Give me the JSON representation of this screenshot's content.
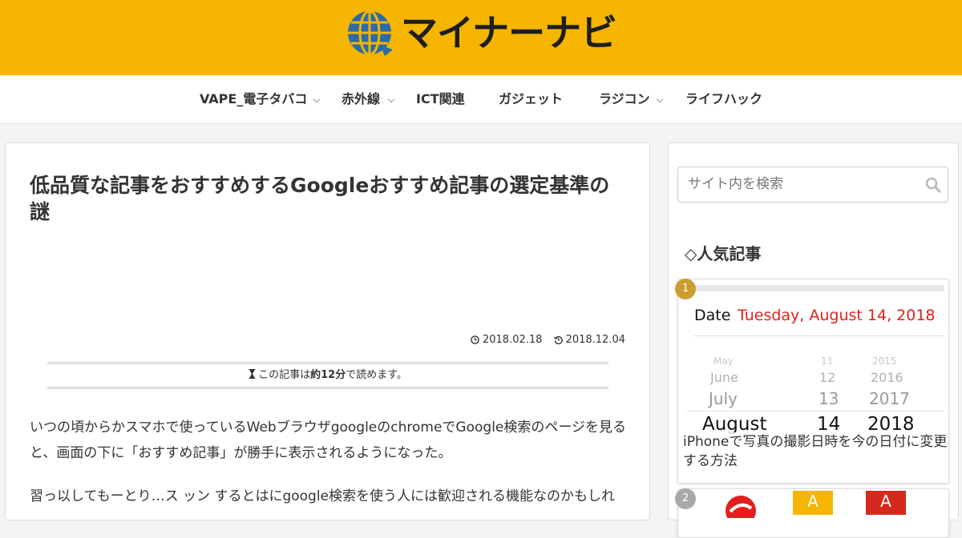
{
  "site": {
    "name": "マイナーナビ"
  },
  "nav": {
    "items": [
      {
        "label": "VAPE_電子タバコ",
        "has_submenu": true
      },
      {
        "label": "赤外線",
        "has_submenu": true
      },
      {
        "label": "ICT関連",
        "has_submenu": false
      },
      {
        "label": "ガジェット",
        "has_submenu": false
      },
      {
        "label": "ラジコン",
        "has_submenu": true
      },
      {
        "label": "ライフハック",
        "has_submenu": false
      }
    ]
  },
  "article": {
    "title": "低品質な記事をおすすめするGoogleおすすめ記事の選定基準の謎",
    "posted": "2018.02.18",
    "updated": "2018.12.04",
    "readtime": {
      "prefix": "この記事は",
      "value": "約12分",
      "suffix": "で読めます。"
    },
    "paragraphs": [
      "いつの頃からかスマホで使っているWebブラウザgoogleのchromeでGoogle検索のページを見ると、画面の下に「おすすめ記事」が勝手に表示されるようになった。",
      "習っ以してもーとり…ス ッン するとはにgoogle検索を使う人には歓迎される機能なのかもしれ"
    ]
  },
  "sidebar": {
    "search": {
      "placeholder": "サイト内を検索"
    },
    "popular": {
      "heading": "◇人気記事",
      "items": [
        {
          "rank": "1",
          "title": "iPhoneで写真の撮影日時を今の日付に変更する方法",
          "thumb": {
            "date_label": "Date",
            "date_value": "Tuesday, August 14, 2018",
            "picker_months": [
              "May",
              "June",
              "July",
              "August"
            ],
            "picker_days": [
              "11",
              "12",
              "13",
              "14"
            ],
            "picker_years": [
              "2015",
              "2016",
              "2017",
              "2018"
            ]
          }
        },
        {
          "rank": "2",
          "thumb_letters": [
            "A",
            "A"
          ]
        }
      ]
    }
  },
  "colors": {
    "header": "#f5b500",
    "globe": "#2c6aa8",
    "date_accent": "#e0221c",
    "badge_gold": "#c9a030"
  }
}
